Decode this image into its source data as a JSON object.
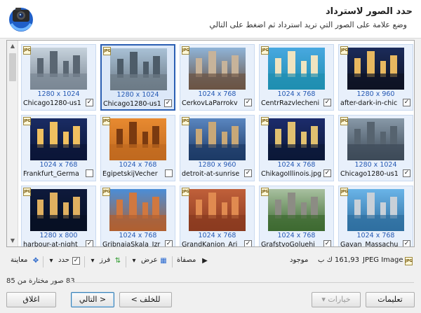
{
  "header": {
    "title": "حدد الصور لاسترداد",
    "subtitle": "وضع علامة على الصور التي تريد استرداد ثم اضغط على التالي"
  },
  "images": [
    {
      "dims": "1280 x 960",
      "name": "after-dark-in-chic",
      "checked": true,
      "selected": false,
      "sky": "#1b2b5a",
      "ground": "#0e1324",
      "bld": "#e8b860"
    },
    {
      "dims": "1024 x 768",
      "name": "CentrRazvlecheni",
      "checked": true,
      "selected": false,
      "sky": "#48a8e0",
      "ground": "#1f8fb0",
      "bld": "#f0e4c0"
    },
    {
      "dims": "1024 x 768",
      "name": "CerkovLaParrokv",
      "checked": true,
      "selected": false,
      "sky": "#8fb4d8",
      "ground": "#6b5444",
      "bld": "#c7b39a"
    },
    {
      "dims": "1280 x 1024",
      "name": "Chicago1280-us1",
      "checked": true,
      "selected": true,
      "sky": "#a9c1d6",
      "ground": "#6c7a86",
      "bld": "#4d5c69"
    },
    {
      "dims": "1280 x 1024",
      "name": "Chicago1280-us1",
      "checked": true,
      "selected": false,
      "sky": "#c6d2dc",
      "ground": "#7b8794",
      "bld": "#5a6672"
    },
    {
      "dims": "1280 x 1024",
      "name": "Chicago1280-us1",
      "checked": true,
      "selected": false,
      "sky": "#8899a8",
      "ground": "#3d4a58",
      "bld": "#56636f"
    },
    {
      "dims": "1024 x 768",
      "name": "ChikagoIllinois.jpg",
      "checked": true,
      "selected": false,
      "sky": "#1c2c6c",
      "ground": "#0c1838",
      "bld": "#e0c070"
    },
    {
      "dims": "1280 x 960",
      "name": "detroit-at-sunrise",
      "checked": true,
      "selected": false,
      "sky": "#5a86c0",
      "ground": "#1d3a66",
      "bld": "#c8a878"
    },
    {
      "dims": "1024 x 768",
      "name": "EgipetskijVecher",
      "checked": false,
      "selected": false,
      "sky": "#e88a30",
      "ground": "#c06a20",
      "bld": "#7a3a10"
    },
    {
      "dims": "1024 x 768",
      "name": "Frankfurt_Germa",
      "checked": false,
      "selected": false,
      "sky": "#1a2c64",
      "ground": "#0b1638",
      "bld": "#f0c060"
    },
    {
      "dims": "1024 x 768",
      "name": "Gavan_Massachu",
      "checked": true,
      "selected": false,
      "sky": "#6ab4e8",
      "ground": "#2f6fa0",
      "bld": "#c8d0d8"
    },
    {
      "dims": "1024 x 768",
      "name": "GrafstvoGoluehi",
      "checked": true,
      "selected": false,
      "sky": "#a8c0a0",
      "ground": "#3d6a30",
      "bld": "#8c8c84"
    },
    {
      "dims": "1024 x 768",
      "name": "GrandKanion_Ari",
      "checked": true,
      "selected": false,
      "sky": "#c0603a",
      "ground": "#8a3a20",
      "bld": "#e08a50"
    },
    {
      "dims": "1024 x 768",
      "name": "GribnaiaSkala_Izr",
      "checked": true,
      "selected": false,
      "sky": "#4a8ed8",
      "ground": "#b06030",
      "bld": "#d07840"
    },
    {
      "dims": "1280 x 800",
      "name": "harbour-at-night",
      "checked": true,
      "selected": false,
      "sky": "#0e1a3c",
      "ground": "#071024",
      "bld": "#e0b060"
    }
  ],
  "toolbar": {
    "file_type": "JPEG Image",
    "file_size": "161,93 ك ب",
    "found": "موجود",
    "filter": "مصفاة",
    "view": "عرض",
    "sort": "فرز",
    "select": "حدد",
    "preview": "معاينة"
  },
  "status": "83 صور مختارة من 85",
  "buttons": {
    "help": "تعليمات",
    "options": "خيارات",
    "back": "< للخلف",
    "next": "التالي >",
    "close": "اغلاق"
  }
}
